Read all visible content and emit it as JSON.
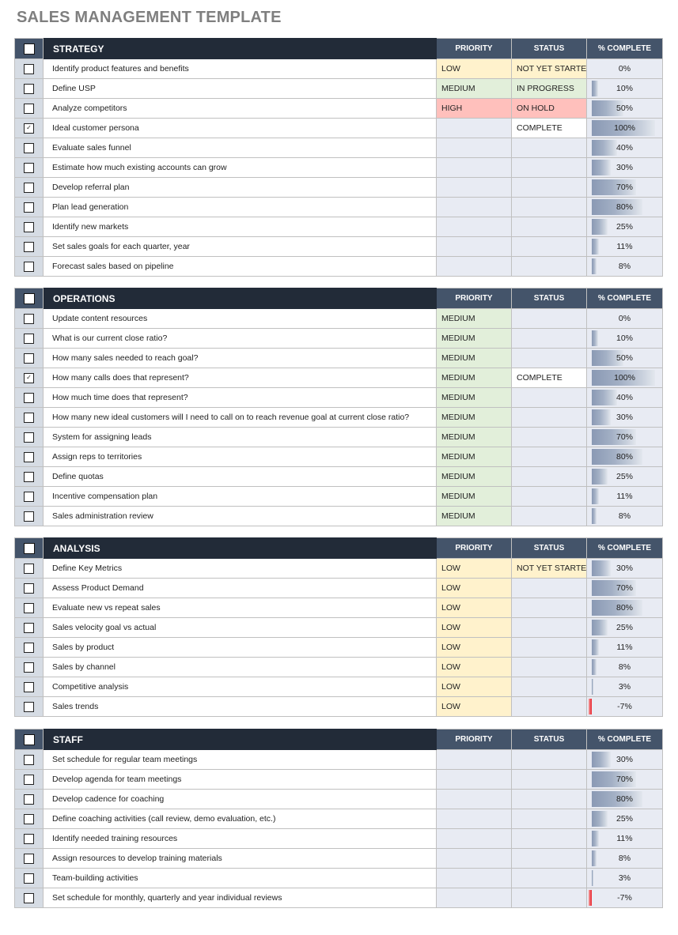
{
  "title": "SALES MANAGEMENT TEMPLATE",
  "columns": {
    "priority": "PRIORITY",
    "status": "STATUS",
    "complete": "% COMPLETE"
  },
  "colors": {
    "header_dark": "#222b38",
    "header_slate": "#44546a",
    "priority_low": "#fff2cc",
    "priority_medium": "#e2efda",
    "priority_high": "#ffc0bc",
    "bar_fill": "#8a99b4",
    "bar_negative": "#e8202a"
  },
  "sections": [
    {
      "title": "STRATEGY",
      "rows": [
        {
          "checked": false,
          "task": "Identify product features and benefits",
          "priority": "LOW",
          "status": "NOT YET STARTED",
          "pct": 0
        },
        {
          "checked": false,
          "task": "Define USP",
          "priority": "MEDIUM",
          "status": "IN PROGRESS",
          "pct": 10
        },
        {
          "checked": false,
          "task": "Analyze competitors",
          "priority": "HIGH",
          "status": "ON HOLD",
          "pct": 50
        },
        {
          "checked": true,
          "task": "Ideal customer persona",
          "priority": "",
          "status": "COMPLETE",
          "pct": 100
        },
        {
          "checked": false,
          "task": "Evaluate sales funnel",
          "priority": "",
          "status": "",
          "pct": 40
        },
        {
          "checked": false,
          "task": "Estimate how much existing accounts can grow",
          "priority": "",
          "status": "",
          "pct": 30
        },
        {
          "checked": false,
          "task": "Develop referral plan",
          "priority": "",
          "status": "",
          "pct": 70
        },
        {
          "checked": false,
          "task": "Plan lead generation",
          "priority": "",
          "status": "",
          "pct": 80
        },
        {
          "checked": false,
          "task": "Identify new markets",
          "priority": "",
          "status": "",
          "pct": 25
        },
        {
          "checked": false,
          "task": "Set sales goals for each quarter, year",
          "priority": "",
          "status": "",
          "pct": 11
        },
        {
          "checked": false,
          "task": "Forecast sales based on pipeline",
          "priority": "",
          "status": "",
          "pct": 8
        }
      ]
    },
    {
      "title": "OPERATIONS",
      "rows": [
        {
          "checked": false,
          "task": "Update content resources",
          "priority": "MEDIUM",
          "status": "",
          "pct": 0
        },
        {
          "checked": false,
          "task": "What is our current close ratio?",
          "priority": "MEDIUM",
          "status": "",
          "pct": 10
        },
        {
          "checked": false,
          "task": "How many sales needed to reach goal?",
          "priority": "MEDIUM",
          "status": "",
          "pct": 50
        },
        {
          "checked": true,
          "task": "How many calls does that represent?",
          "priority": "MEDIUM",
          "status": "COMPLETE",
          "pct": 100
        },
        {
          "checked": false,
          "task": "How much time does that represent?",
          "priority": "MEDIUM",
          "status": "",
          "pct": 40
        },
        {
          "checked": false,
          "task": "How many new ideal customers will I need to call on to reach revenue goal at current close ratio?",
          "priority": "MEDIUM",
          "status": "",
          "pct": 30
        },
        {
          "checked": false,
          "task": "System for assigning leads",
          "priority": "MEDIUM",
          "status": "",
          "pct": 70
        },
        {
          "checked": false,
          "task": "Assign reps to territories",
          "priority": "MEDIUM",
          "status": "",
          "pct": 80
        },
        {
          "checked": false,
          "task": "Define quotas",
          "priority": "MEDIUM",
          "status": "",
          "pct": 25
        },
        {
          "checked": false,
          "task": "Incentive compensation plan",
          "priority": "MEDIUM",
          "status": "",
          "pct": 11
        },
        {
          "checked": false,
          "task": "Sales administration review",
          "priority": "MEDIUM",
          "status": "",
          "pct": 8
        }
      ]
    },
    {
      "title": "ANALYSIS",
      "rows": [
        {
          "checked": false,
          "task": "Define Key Metrics",
          "priority": "LOW",
          "status": "NOT YET STARTED",
          "pct": 30
        },
        {
          "checked": false,
          "task": "Assess Product Demand",
          "priority": "LOW",
          "status": "",
          "pct": 70
        },
        {
          "checked": false,
          "task": "Evaluate new vs repeat sales",
          "priority": "LOW",
          "status": "",
          "pct": 80
        },
        {
          "checked": false,
          "task": "Sales velocity goal vs actual",
          "priority": "LOW",
          "status": "",
          "pct": 25
        },
        {
          "checked": false,
          "task": "Sales by product",
          "priority": "LOW",
          "status": "",
          "pct": 11
        },
        {
          "checked": false,
          "task": "Sales by channel",
          "priority": "LOW",
          "status": "",
          "pct": 8
        },
        {
          "checked": false,
          "task": "Competitive analysis",
          "priority": "LOW",
          "status": "",
          "pct": 3
        },
        {
          "checked": false,
          "task": "Sales trends",
          "priority": "LOW",
          "status": "",
          "pct": -7
        }
      ]
    },
    {
      "title": "STAFF",
      "rows": [
        {
          "checked": false,
          "task": "Set schedule for regular team meetings",
          "priority": "",
          "status": "",
          "pct": 30
        },
        {
          "checked": false,
          "task": "Develop agenda for team meetings",
          "priority": "",
          "status": "",
          "pct": 70
        },
        {
          "checked": false,
          "task": "Develop cadence for coaching",
          "priority": "",
          "status": "",
          "pct": 80
        },
        {
          "checked": false,
          "task": "Define coaching activities (call review, demo evaluation, etc.)",
          "priority": "",
          "status": "",
          "pct": 25
        },
        {
          "checked": false,
          "task": "Identify needed training resources",
          "priority": "",
          "status": "",
          "pct": 11
        },
        {
          "checked": false,
          "task": "Assign resources to develop training materials",
          "priority": "",
          "status": "",
          "pct": 8
        },
        {
          "checked": false,
          "task": "Team-building activities",
          "priority": "",
          "status": "",
          "pct": 3
        },
        {
          "checked": false,
          "task": "Set schedule for monthly, quarterly and year individual reviews",
          "priority": "",
          "status": "",
          "pct": -7
        }
      ]
    }
  ]
}
